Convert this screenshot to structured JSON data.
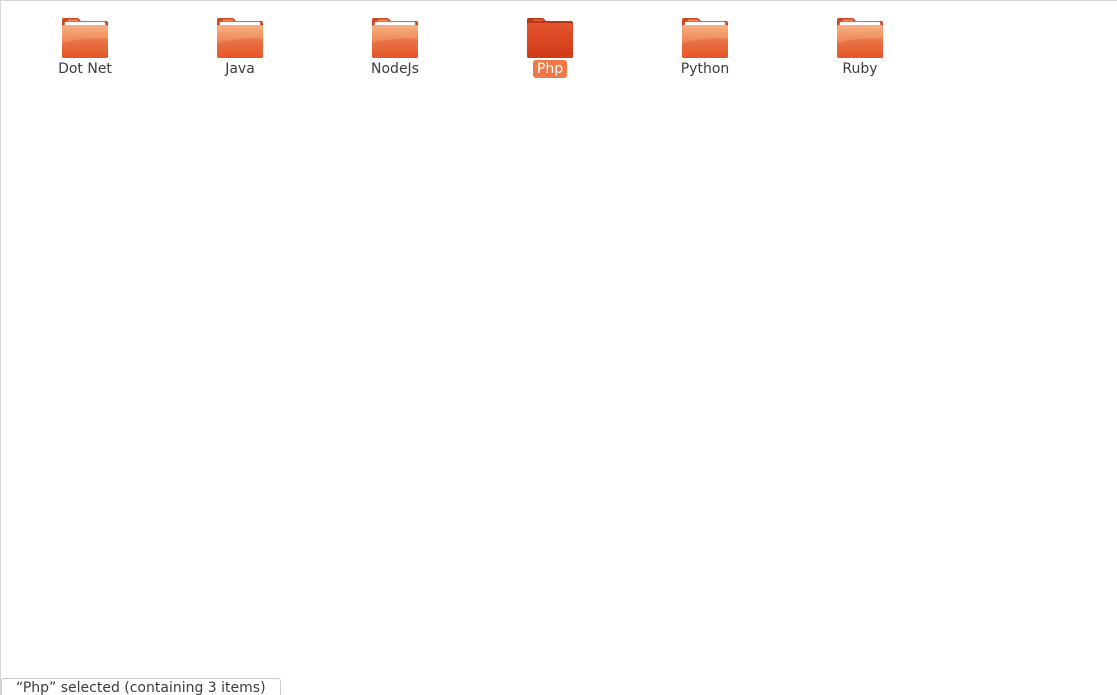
{
  "folders": [
    {
      "name": "Dot Net",
      "selected": false
    },
    {
      "name": "Java",
      "selected": false
    },
    {
      "name": "NodeJs",
      "selected": false
    },
    {
      "name": "Php",
      "selected": true
    },
    {
      "name": "Python",
      "selected": false
    },
    {
      "name": "Ruby",
      "selected": false
    }
  ],
  "status": {
    "text": "“Php” selected  (containing 3 items)"
  },
  "colors": {
    "folder_normal_top": "#f5a070",
    "folder_normal_bottom": "#e85a2a",
    "folder_selected": "#d8401c",
    "selection_highlight": "#f07746"
  },
  "icons": {
    "folder": "folder-icon"
  }
}
